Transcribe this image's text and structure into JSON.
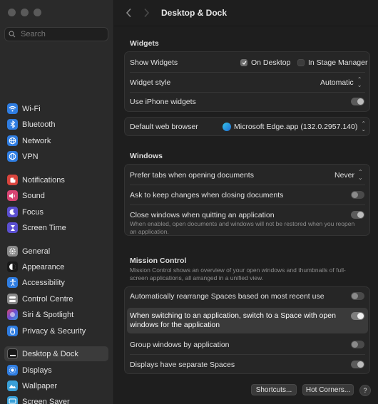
{
  "window": {
    "title": "Desktop & Dock"
  },
  "search": {
    "placeholder": "Search"
  },
  "sidebar": {
    "items": [
      {
        "label": "Wi-Fi",
        "icon": "wifi-icon",
        "color": "#2f7de1"
      },
      {
        "label": "Bluetooth",
        "icon": "bluetooth-icon",
        "color": "#2f7de1"
      },
      {
        "label": "Network",
        "icon": "network-icon",
        "color": "#2f7de1"
      },
      {
        "label": "VPN",
        "icon": "vpn-icon",
        "color": "#2f7de1"
      },
      {
        "label": "Notifications",
        "icon": "notifications-icon",
        "color": "#d9453d"
      },
      {
        "label": "Sound",
        "icon": "sound-icon",
        "color": "#d94473"
      },
      {
        "label": "Focus",
        "icon": "focus-icon",
        "color": "#5b4fd1"
      },
      {
        "label": "Screen Time",
        "icon": "screen-time-icon",
        "color": "#5b4fd1"
      },
      {
        "label": "General",
        "icon": "general-icon",
        "color": "#8a8a8a"
      },
      {
        "label": "Appearance",
        "icon": "appearance-icon",
        "color": "#1a1a1a"
      },
      {
        "label": "Accessibility",
        "icon": "accessibility-icon",
        "color": "#2f7de1"
      },
      {
        "label": "Control Centre",
        "icon": "control-centre-icon",
        "color": "#8a8a8a"
      },
      {
        "label": "Siri & Spotlight",
        "icon": "siri-icon",
        "color": "#b04bd6"
      },
      {
        "label": "Privacy & Security",
        "icon": "privacy-icon",
        "color": "#2f7de1"
      },
      {
        "label": "Desktop & Dock",
        "icon": "desktop-dock-icon",
        "color": "#1a1a1a"
      },
      {
        "label": "Displays",
        "icon": "displays-icon",
        "color": "#2f7de1"
      },
      {
        "label": "Wallpaper",
        "icon": "wallpaper-icon",
        "color": "#39a0d8"
      },
      {
        "label": "Screen Saver",
        "icon": "screen-saver-icon",
        "color": "#39a0d8"
      }
    ]
  },
  "widgets": {
    "title": "Widgets",
    "show_widgets": "Show Widgets",
    "on_desktop": "On Desktop",
    "in_stage_manager": "In Stage Manager",
    "widget_style": "Widget style",
    "widget_style_value": "Automatic",
    "use_iphone": "Use iPhone widgets"
  },
  "browser": {
    "label": "Default web browser",
    "value": "Microsoft Edge.app (132.0.2957.140)"
  },
  "windows": {
    "title": "Windows",
    "prefer_tabs": "Prefer tabs when opening documents",
    "prefer_tabs_value": "Never",
    "ask_keep": "Ask to keep changes when closing documents",
    "close_windows": "Close windows when quitting an application",
    "close_windows_sub": "When enabled, open documents and windows will not be restored when you reopen an application."
  },
  "mission_control": {
    "title": "Mission Control",
    "description": "Mission Control shows an overview of your open windows and thumbnails of full-screen applications, all arranged in a unified view.",
    "auto_rearrange": "Automatically rearrange Spaces based on most recent use",
    "switch_space": "When switching to an application, switch to a Space with open windows for the application",
    "group_windows": "Group windows by application",
    "separate_spaces": "Displays have separate Spaces"
  },
  "buttons": {
    "shortcuts": "Shortcuts...",
    "hot_corners": "Hot Corners...",
    "help": "?"
  }
}
